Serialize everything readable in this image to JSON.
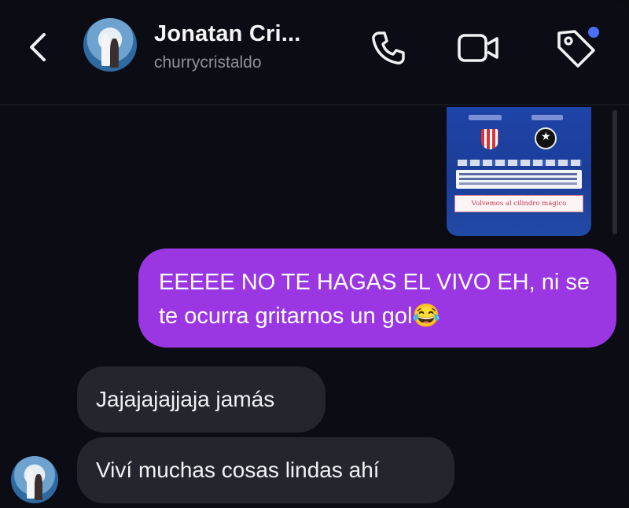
{
  "header": {
    "back_icon": "chevron-left-icon",
    "name": "Jonatan Cri...",
    "username": "churrycristaldo",
    "actions": [
      "phone-icon",
      "video-camera-icon",
      "tag-icon"
    ],
    "notification_dot_color": "#4c6ef5"
  },
  "shared_post": {
    "caption": "Volvemos al cilindro mágico"
  },
  "messages": [
    {
      "direction": "outgoing",
      "text": "EEEEE NO TE HAGAS EL VIVO EH, ni se te ocurra gritarnos un gol😂",
      "bubble_color": "#9b36e3"
    },
    {
      "direction": "incoming",
      "text": "Jajajajajjaja jamás",
      "bubble_color": "#25252e"
    },
    {
      "direction": "incoming",
      "text": "Viví muchas cosas lindas ahí",
      "bubble_color": "#25252e"
    }
  ]
}
